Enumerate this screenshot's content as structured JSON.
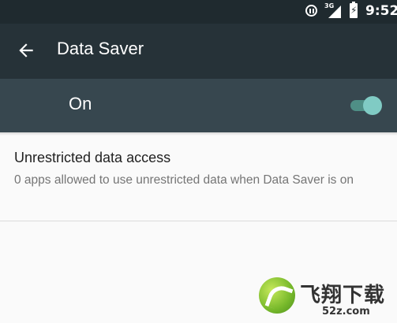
{
  "status_bar": {
    "network": "3G",
    "time": "9:52",
    "icons": [
      "pause-circle-icon",
      "signal-icon",
      "battery-charging-icon"
    ]
  },
  "app_bar": {
    "title": "Data Saver",
    "back_icon": "arrow-back-icon"
  },
  "master_switch": {
    "label": "On",
    "checked": true,
    "accent_color": "#80cbc4"
  },
  "preferences": [
    {
      "title": "Unrestricted data access",
      "summary": "0 apps allowed to use unrestricted data when Data Saver is on"
    }
  ],
  "watermark": {
    "brand": "飞翔下载",
    "domain": "52z.com"
  },
  "colors": {
    "status_bar": "#1f2a2f",
    "app_bar": "#263238",
    "switch_bar": "#37474f",
    "background": "#fafafa"
  }
}
